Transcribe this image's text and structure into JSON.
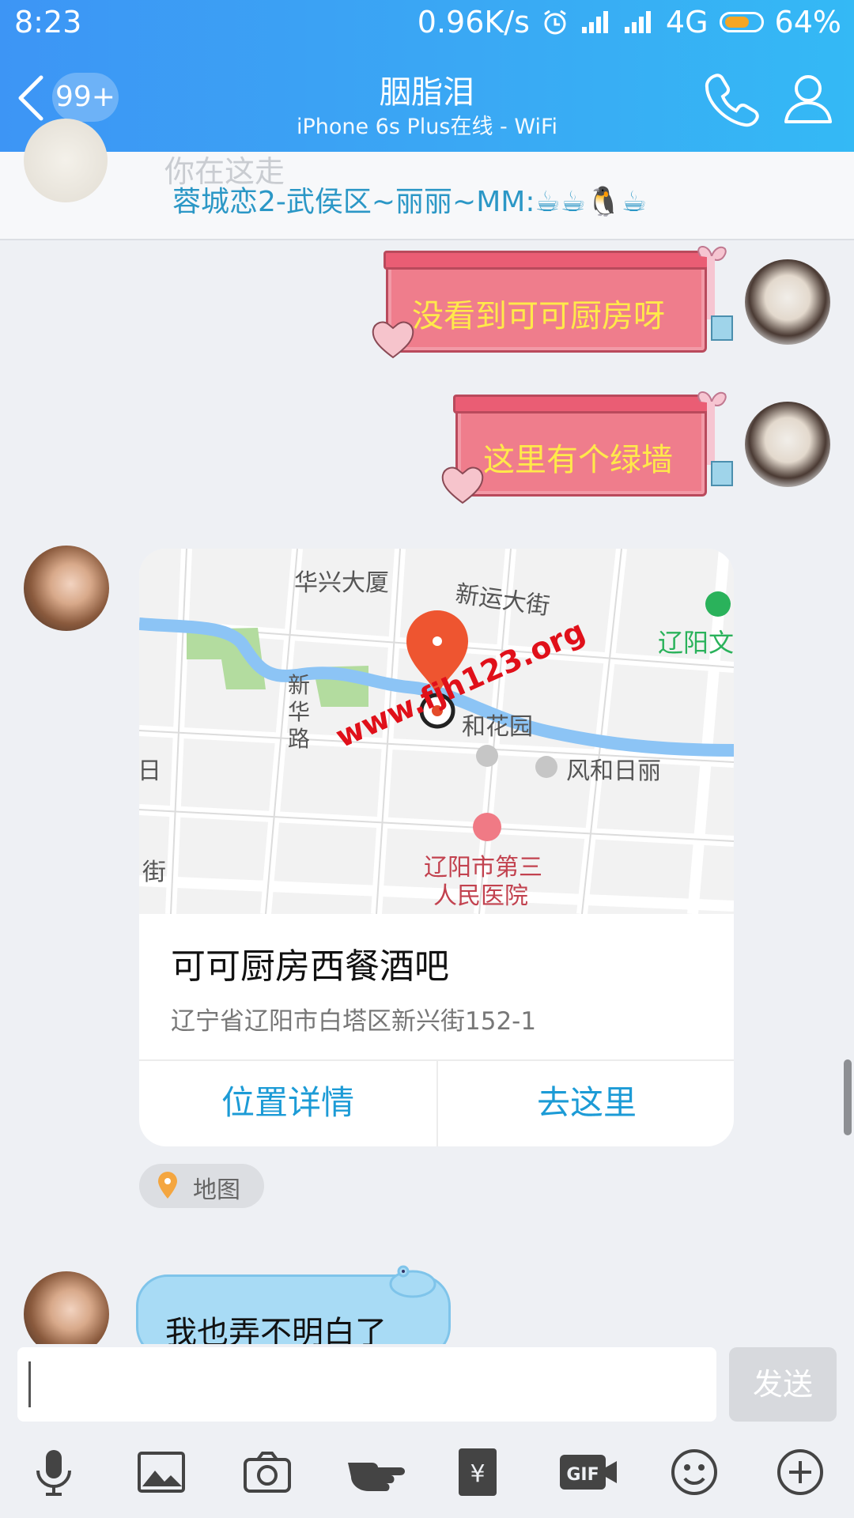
{
  "status_bar": {
    "time": "8:23",
    "speed": "0.96K/s",
    "network": "4G",
    "battery": "64%"
  },
  "header": {
    "unread_badge": "99+",
    "title": "胭脂泪",
    "subtitle": "iPhone 6s Plus在线 - WiFi"
  },
  "previous_message": {
    "faint_text": "你在这走",
    "text": "蓉城恋2-武侯区~丽丽~MM:☕☕🐧☕"
  },
  "messages": [
    {
      "sender": "self",
      "type": "text",
      "text": "没看到可可厨房呀"
    },
    {
      "sender": "self",
      "type": "text",
      "text": "这里有个绿墙"
    },
    {
      "sender": "other",
      "type": "location",
      "map_labels": [
        "华兴大厦",
        "新运大街",
        "辽阳文",
        "新华路",
        "和花园",
        "风和日丽",
        "日",
        "街",
        "辽阳市第三",
        "人民医院"
      ],
      "watermark": "www.fjh123.org",
      "place_name": "可可厨房西餐酒吧",
      "address": "辽宁省辽阳市白塔区新兴街152-1",
      "action_left": "位置详情",
      "action_right": "去这里",
      "chip_label": "地图"
    },
    {
      "sender": "other",
      "type": "text",
      "text": "我也弄不明白了"
    }
  ],
  "composer": {
    "value": "",
    "send_label": "发送"
  },
  "toolbar_icons": [
    "microphone-icon",
    "image-icon",
    "camera-icon",
    "poke-icon",
    "red-packet-icon",
    "gif-icon",
    "emoji-icon",
    "plus-icon"
  ],
  "colors": {
    "header_start": "#3d95f5",
    "header_end": "#34b9f5",
    "link_blue": "#1c9bd6",
    "pink_bubble": "#ef7d8c",
    "pink_text": "#ffe94a"
  }
}
